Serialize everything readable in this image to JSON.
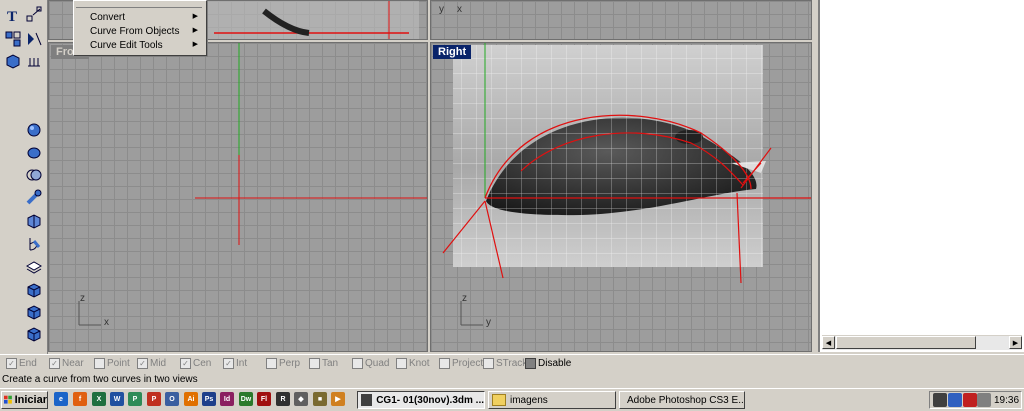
{
  "menu": {
    "items": [
      {
        "label": "Convert",
        "submenu": true
      },
      {
        "label": "Curve From Objects",
        "submenu": true
      },
      {
        "label": "Curve Edit Tools",
        "submenu": true
      }
    ]
  },
  "viewports": {
    "front": {
      "label": "Front",
      "axis_z": "z",
      "axis_x": "x"
    },
    "right": {
      "label": "Right",
      "axis_z": "z",
      "axis_y": "y"
    },
    "top_right": {
      "axis_y": "y",
      "axis_x": "x"
    }
  },
  "osnap": {
    "items": [
      {
        "label": "End",
        "checked": true
      },
      {
        "label": "Near",
        "checked": true
      },
      {
        "label": "Point",
        "checked": false
      },
      {
        "label": "Mid",
        "checked": true
      },
      {
        "label": "Cen",
        "checked": true
      },
      {
        "label": "Int",
        "checked": true
      },
      {
        "label": "Perp",
        "checked": false
      },
      {
        "label": "Tan",
        "checked": false
      },
      {
        "label": "Quad",
        "checked": false
      },
      {
        "label": "Knot",
        "checked": false
      },
      {
        "label": "Project",
        "checked": false
      },
      {
        "label": "STrack",
        "checked": false
      },
      {
        "label": "Disable",
        "checked": false
      }
    ]
  },
  "status": {
    "text": "Create a curve from two curves in two views"
  },
  "taskbar": {
    "start_label": "Iniciar",
    "tasks": [
      {
        "label": "CG1- 01(30nov).3dm ...",
        "active": true
      },
      {
        "label": "imagens",
        "active": false
      },
      {
        "label": "Adobe Photoshop CS3 E...",
        "active": false
      }
    ],
    "clock": "19:36"
  },
  "colors": {
    "accent": "#0a246a",
    "curve": "#e01010",
    "axis_green": "#22aa22"
  }
}
